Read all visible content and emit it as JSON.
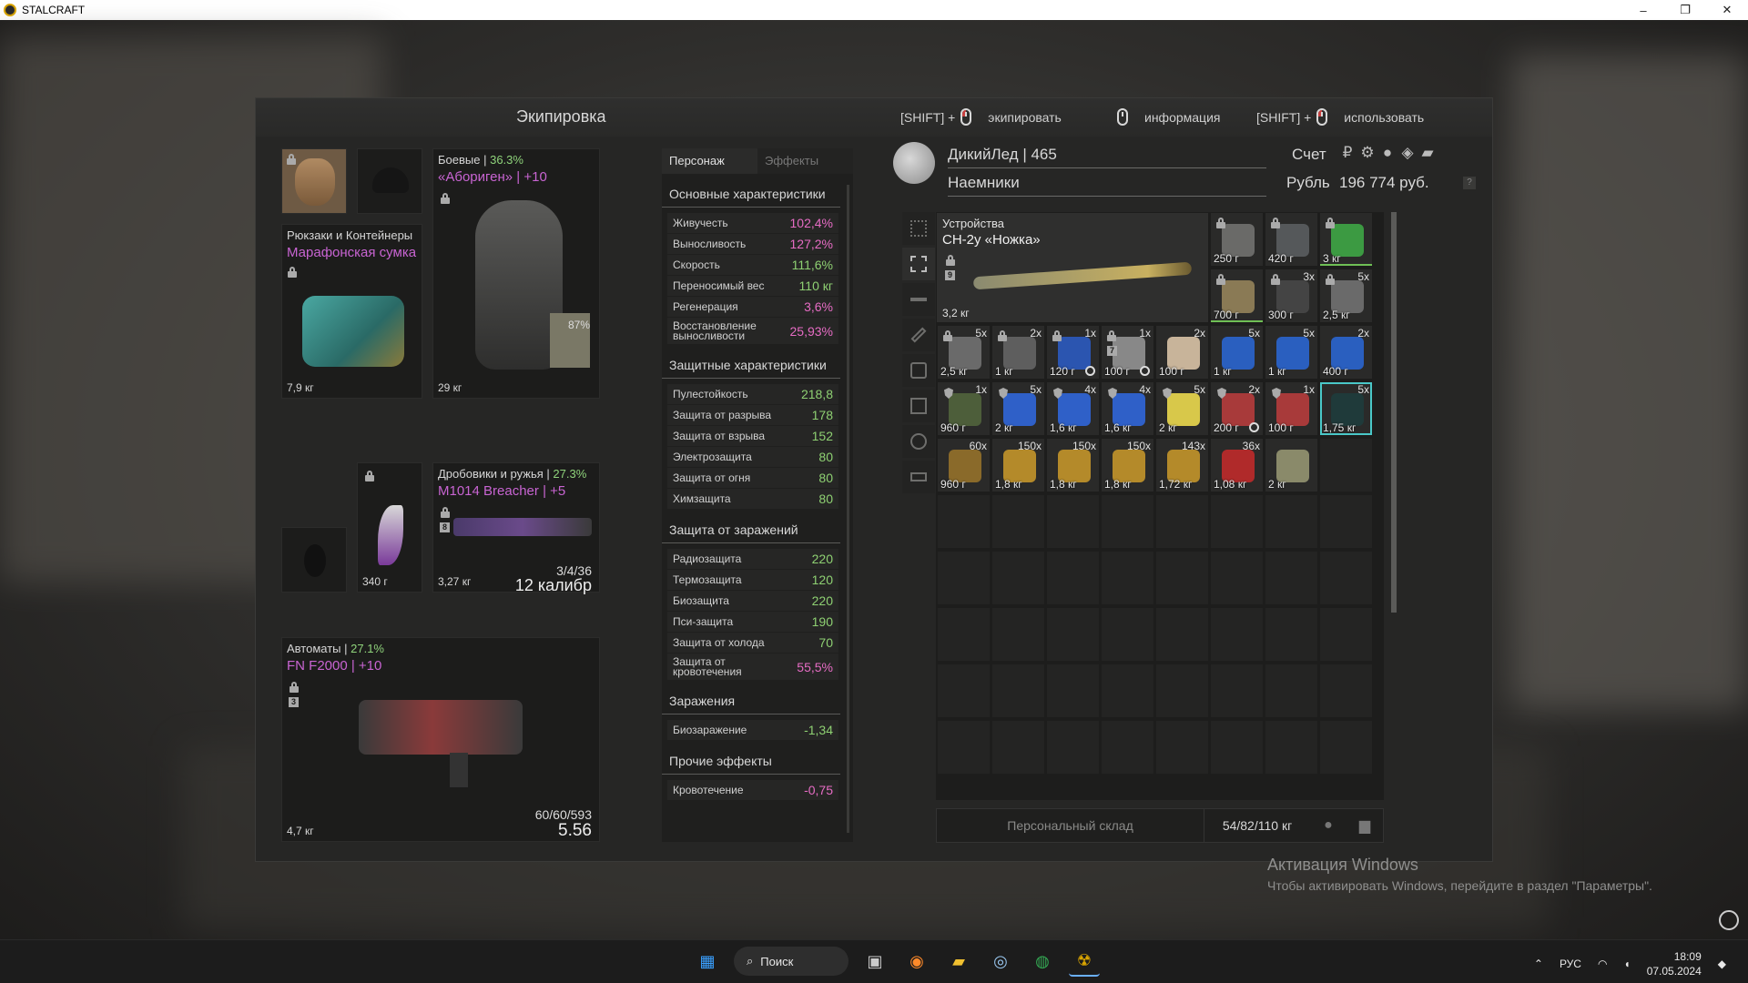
{
  "window": {
    "title": "STALCRAFT",
    "controls": [
      "–",
      "❐",
      "✕"
    ]
  },
  "panel": {
    "title": "Экипировка",
    "hints": [
      {
        "prefix": "[SHIFT] +",
        "label": "экипировать"
      },
      {
        "prefix": "",
        "label": "информация"
      },
      {
        "prefix": "[SHIFT] +",
        "label": "использовать"
      }
    ]
  },
  "slots": {
    "backpack": {
      "label": "Рюкзаки и Контейнеры",
      "name": "Марафонская сумка",
      "weight": "7,9 кг"
    },
    "armor": {
      "label": "Боевые",
      "pct": "36.3%",
      "name": "«Абориген» | +10",
      "weight": "29 кг",
      "durability": "87%"
    },
    "melee": {
      "weight": "340 г"
    },
    "shotgun": {
      "label": "Дробовики и ружья",
      "pct": "27.3%",
      "name": "M1014 Breacher | +5",
      "weight": "3,27 кг",
      "ammo": "3/4/36",
      "caliber": "12 калибр",
      "badge": "8"
    },
    "rifle": {
      "label": "Автоматы",
      "pct": "27.1%",
      "name": "FN F2000 | +10",
      "weight": "4,7 кг",
      "ammo": "60/60/593",
      "caliber": "5.56",
      "badge": "3"
    }
  },
  "stats": {
    "tabs": [
      "Персонаж",
      "Эффекты"
    ],
    "sections": [
      {
        "title": "Основные характеристики",
        "rows": [
          {
            "k": "Живучесть",
            "v": "102,4%",
            "c": "pink"
          },
          {
            "k": "Выносливость",
            "v": "127,2%",
            "c": "pink"
          },
          {
            "k": "Скорость",
            "v": "111,6%",
            "c": "green"
          },
          {
            "k": "Переносимый вес",
            "v": "110 кг",
            "c": "green"
          },
          {
            "k": "Регенерация",
            "v": "3,6%",
            "c": "pink"
          },
          {
            "k": "Восстановление выносливости",
            "v": "25,93%",
            "c": "pink",
            "tall": true
          }
        ]
      },
      {
        "title": "Защитные характеристики",
        "rows": [
          {
            "k": "Пулестойкость",
            "v": "218,8",
            "c": "green"
          },
          {
            "k": "Защита от разрыва",
            "v": "178",
            "c": "green"
          },
          {
            "k": "Защита от взрыва",
            "v": "152",
            "c": "green"
          },
          {
            "k": "Электрозащита",
            "v": "80",
            "c": "green"
          },
          {
            "k": "Защита от огня",
            "v": "80",
            "c": "green"
          },
          {
            "k": "Химзащита",
            "v": "80",
            "c": "green"
          }
        ]
      },
      {
        "title": "Защита от заражений",
        "rows": [
          {
            "k": "Радиозащита",
            "v": "220",
            "c": "green"
          },
          {
            "k": "Термозащита",
            "v": "120",
            "c": "green"
          },
          {
            "k": "Биозащита",
            "v": "220",
            "c": "green"
          },
          {
            "k": "Пси-защита",
            "v": "190",
            "c": "green"
          },
          {
            "k": "Защита от холода",
            "v": "70",
            "c": "green"
          },
          {
            "k": "Защита от кровотечения",
            "v": "55,5%",
            "c": "pink",
            "tall": true
          }
        ]
      },
      {
        "title": "Заражения",
        "rows": [
          {
            "k": "Биозаражение",
            "v": "-1,34",
            "c": "green"
          }
        ]
      },
      {
        "title": "Прочие эффекты",
        "rows": [
          {
            "k": "Кровотечение",
            "v": "-0,75",
            "c": "pink"
          }
        ]
      }
    ]
  },
  "account": {
    "name": "ДикийЛед | 465",
    "faction": "Наемники",
    "account_label": "Счет",
    "currency_label": "Рубль",
    "balance": "196 774 руб."
  },
  "inventory": {
    "device": {
      "label": "Устройства",
      "name": "СН-2у «Ножка»",
      "weight": "3,2 кг",
      "badge": "9"
    },
    "items": [
      {
        "col": 5,
        "row": 0,
        "w": "250 г",
        "lock": true,
        "color": "#6a6a68"
      },
      {
        "col": 6,
        "row": 0,
        "w": "420 г",
        "lock": true,
        "color": "#55585a"
      },
      {
        "col": 7,
        "row": 0,
        "w": "3 кг",
        "lock": true,
        "color": "#3c9a42",
        "green": true
      },
      {
        "col": 5,
        "row": 1,
        "w": "700 г",
        "lock": true,
        "color": "#8a7a55",
        "green": true
      },
      {
        "col": 6,
        "row": 1,
        "w": "300 г",
        "cnt": "3x",
        "lock": true,
        "color": "#444"
      },
      {
        "col": 7,
        "row": 1,
        "w": "2,5 кг",
        "cnt": "5x",
        "lock": true,
        "color": "#6a6a6a"
      },
      {
        "col": 0,
        "row": 2,
        "w": "2,5 кг",
        "cnt": "5x",
        "lock": true,
        "color": "#6a6a6a"
      },
      {
        "col": 1,
        "row": 2,
        "w": "1 кг",
        "cnt": "2x",
        "lock": true,
        "color": "#5e5e5e"
      },
      {
        "col": 2,
        "row": 2,
        "w": "120 г",
        "cnt": "1x",
        "lock": true,
        "color": "#2b55b0",
        "clock": true
      },
      {
        "col": 3,
        "row": 2,
        "w": "100 г",
        "cnt": "1x",
        "lock": true,
        "color": "#888",
        "clock": true,
        "badge": "7"
      },
      {
        "col": 4,
        "row": 2,
        "w": "100 г",
        "cnt": "2x",
        "color": "#c8b49a"
      },
      {
        "col": 5,
        "row": 2,
        "w": "1 кг",
        "cnt": "5x",
        "color": "#2a5fbf"
      },
      {
        "col": 6,
        "row": 2,
        "w": "1 кг",
        "cnt": "5x",
        "color": "#2a5fbf"
      },
      {
        "col": 7,
        "row": 2,
        "w": "400 г",
        "cnt": "2x",
        "color": "#2a5fbf"
      },
      {
        "col": 0,
        "row": 3,
        "w": "960 г",
        "cnt": "1x",
        "shield": true,
        "color": "#4d5e3a"
      },
      {
        "col": 1,
        "row": 3,
        "w": "2 кг",
        "cnt": "5x",
        "shield": true,
        "color": "#2f60c8"
      },
      {
        "col": 2,
        "row": 3,
        "w": "1,6 кг",
        "cnt": "4x",
        "shield": true,
        "color": "#2f60c8"
      },
      {
        "col": 3,
        "row": 3,
        "w": "1,6 кг",
        "cnt": "4x",
        "shield": true,
        "color": "#2f60c8"
      },
      {
        "col": 4,
        "row": 3,
        "w": "2 кг",
        "cnt": "5x",
        "shield": true,
        "color": "#d8c84a"
      },
      {
        "col": 5,
        "row": 3,
        "w": "200 г",
        "cnt": "2x",
        "shield": true,
        "color": "#a83a3a",
        "clock": true
      },
      {
        "col": 6,
        "row": 3,
        "w": "100 г",
        "cnt": "1x",
        "shield": true,
        "color": "#a83a3a"
      },
      {
        "col": 7,
        "row": 3,
        "w": "1,75 кг",
        "cnt": "5x",
        "color": "#1f3a3a",
        "cyan": true
      },
      {
        "col": 0,
        "row": 4,
        "w": "960 г",
        "cnt": "60x",
        "color": "#8a6a2a"
      },
      {
        "col": 1,
        "row": 4,
        "w": "1,8 кг",
        "cnt": "150x",
        "color": "#b48a2a"
      },
      {
        "col": 2,
        "row": 4,
        "w": "1,8 кг",
        "cnt": "150x",
        "color": "#b48a2a"
      },
      {
        "col": 3,
        "row": 4,
        "w": "1,8 кг",
        "cnt": "150x",
        "color": "#b48a2a"
      },
      {
        "col": 4,
        "row": 4,
        "w": "1,72 кг",
        "cnt": "143x",
        "color": "#b48a2a"
      },
      {
        "col": 5,
        "row": 4,
        "w": "1,08 кг",
        "cnt": "36x",
        "color": "#b02a2a"
      },
      {
        "col": 6,
        "row": 4,
        "w": "2 кг",
        "color": "#8a8a6a"
      }
    ]
  },
  "storage": {
    "button": "Персональный склад",
    "weight": "54/82/110 кг"
  },
  "watermark": {
    "line1": "Активация Windows",
    "line2": "Чтобы активировать Windows, перейдите в раздел \"Параметры\"."
  },
  "taskbar": {
    "search": "Поиск",
    "lang": "РУС",
    "time": "18:09",
    "date": "07.05.2024"
  }
}
